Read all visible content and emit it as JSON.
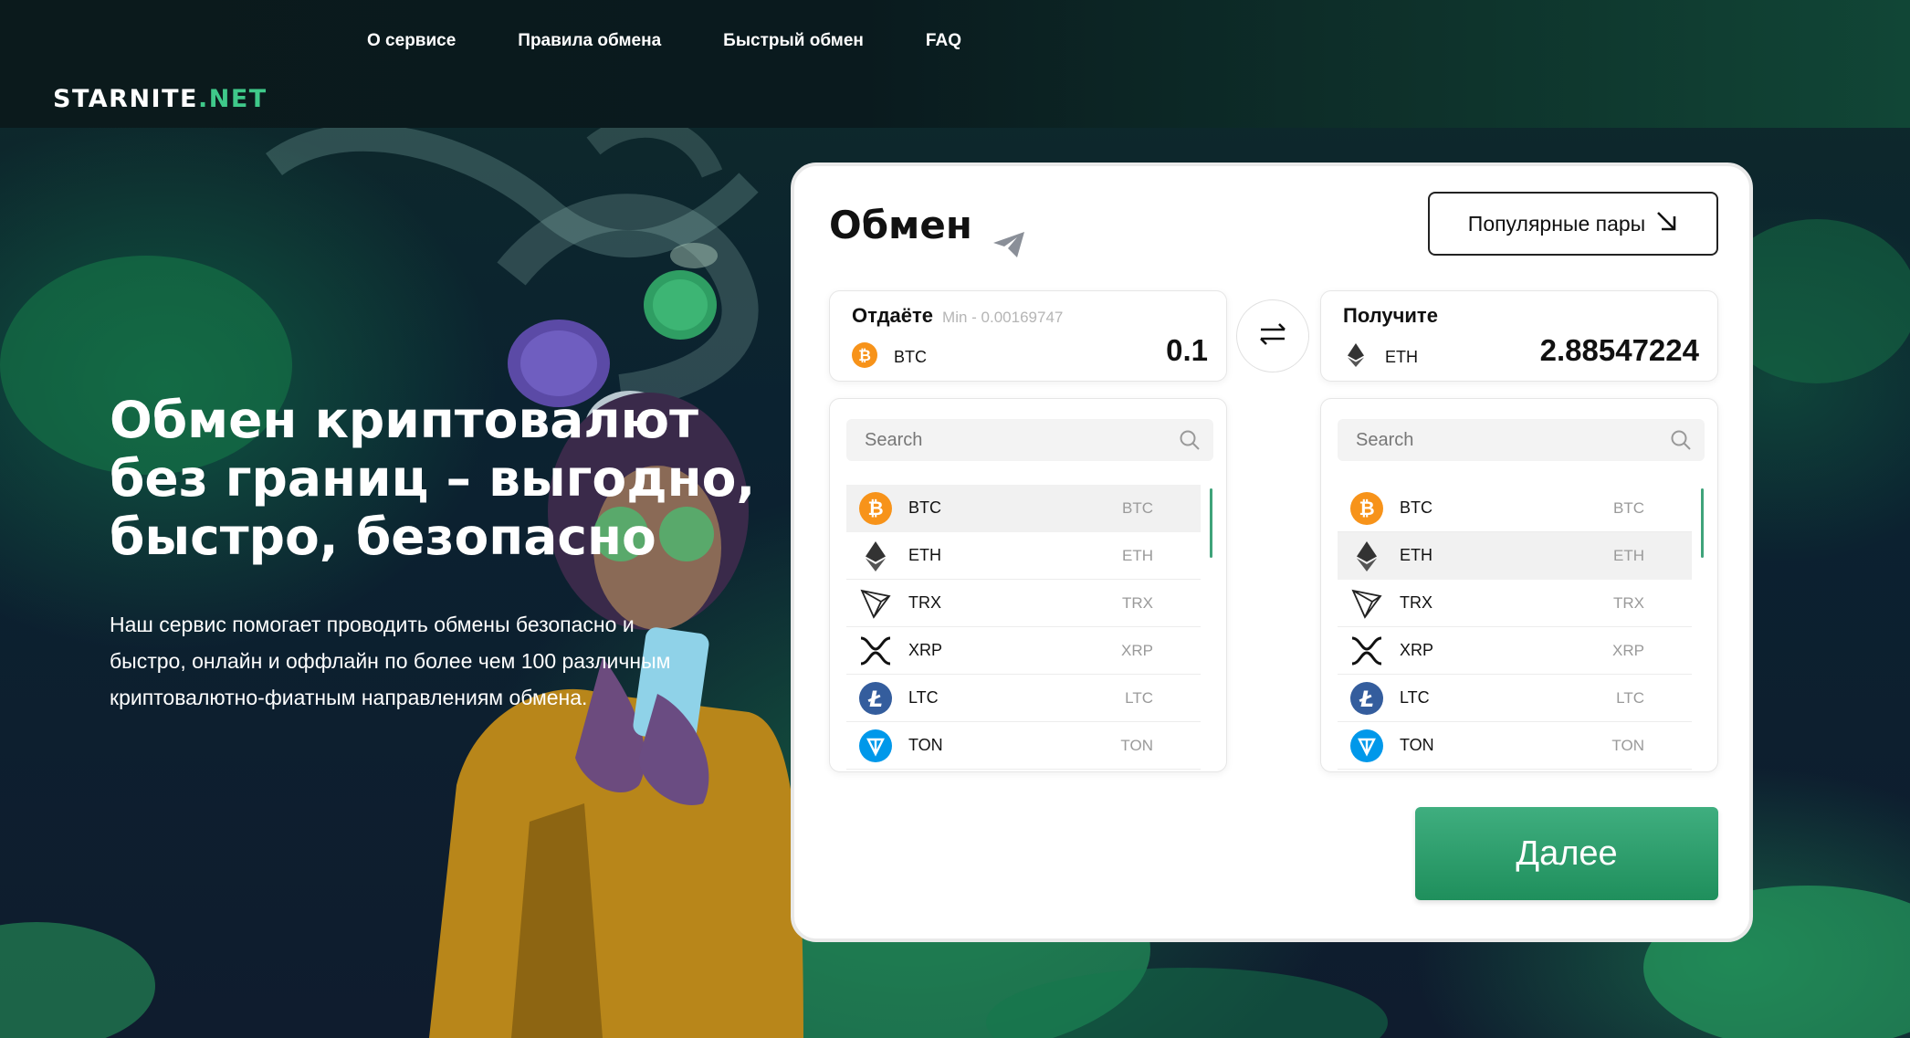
{
  "header": {
    "nav": [
      "О сервисе",
      "Правила обмена",
      "Быстрый обмен",
      "FAQ"
    ],
    "logo_main": "STARNITE",
    "logo_accent": ".NET"
  },
  "hero": {
    "title_lines": [
      "Обмен криптовалют",
      "без границ – выгодно,",
      "быстро, безопасно"
    ],
    "desc_lines": [
      "Наш сервис помогает проводить обмены безопасно и",
      "быстро, онлайн и оффлайн по более чем 100 различным",
      "криптовалютно-фиатным направлениям обмена."
    ]
  },
  "exchange": {
    "title": "Обмен",
    "popular_label": "Популярные пары",
    "give": {
      "label": "Отдаёте",
      "min": "Min - 0.00169747",
      "coin": "BTC",
      "amount": "0.1"
    },
    "get": {
      "label": "Получите",
      "coin": "ETH",
      "amount": "2.88547224"
    },
    "search_placeholder": "Search",
    "coins": [
      {
        "name": "BTC",
        "code": "BTC",
        "icon": "bitcoin-icon"
      },
      {
        "name": "ETH",
        "code": "ETH",
        "icon": "ethereum-icon"
      },
      {
        "name": "TRX",
        "code": "TRX",
        "icon": "tron-icon"
      },
      {
        "name": "XRP",
        "code": "XRP",
        "icon": "xrp-icon"
      },
      {
        "name": "LTC",
        "code": "LTC",
        "icon": "litecoin-icon"
      },
      {
        "name": "TON",
        "code": "TON",
        "icon": "ton-icon"
      }
    ],
    "selected_give": "BTC",
    "selected_get": "ETH",
    "next_label": "Далее"
  },
  "colors": {
    "accent": "#3fc98a",
    "button_green": "#2e9e6b",
    "btc": "#f7931a",
    "ltc": "#345d9d",
    "ton": "#0098ea"
  }
}
